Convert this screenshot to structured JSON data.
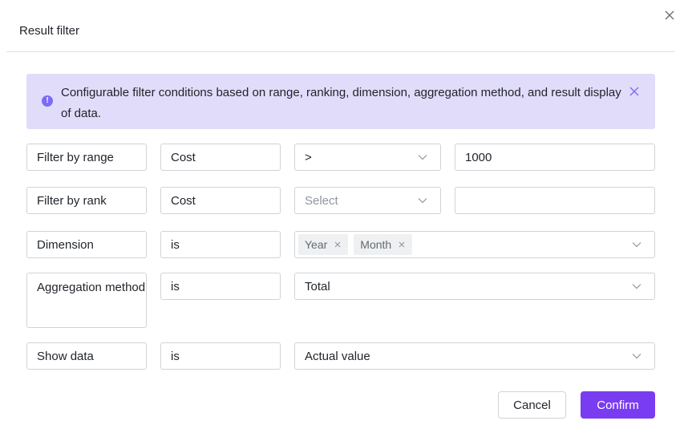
{
  "dialog": {
    "title": "Result filter",
    "close_icon": "close-icon"
  },
  "alert": {
    "icon": "info-icon",
    "icon_glyph": "!",
    "text": "Configurable filter conditions based on range, ranking, dimension, aggregation method, and result display of data.",
    "close_icon": "close-icon"
  },
  "rows": {
    "range": {
      "label": "Filter by range",
      "field": "Cost",
      "operator": ">",
      "value": "1000"
    },
    "rank": {
      "label": "Filter by rank",
      "field": "Cost",
      "operator_placeholder": "Select",
      "value": ""
    },
    "dimension": {
      "label": "Dimension",
      "operator": "is",
      "tags": [
        "Year",
        "Month"
      ]
    },
    "aggregation": {
      "label": "Aggregation method",
      "operator": "is",
      "value": "Total"
    },
    "show_data": {
      "label": "Show data",
      "operator": "is",
      "value": "Actual value"
    }
  },
  "footer": {
    "cancel_label": "Cancel",
    "confirm_label": "Confirm"
  },
  "colors": {
    "accent": "#7a3cf0",
    "alert_bg": "#e1dcfa",
    "alert_icon": "#7b6cf6",
    "border": "#d0d3d6"
  }
}
